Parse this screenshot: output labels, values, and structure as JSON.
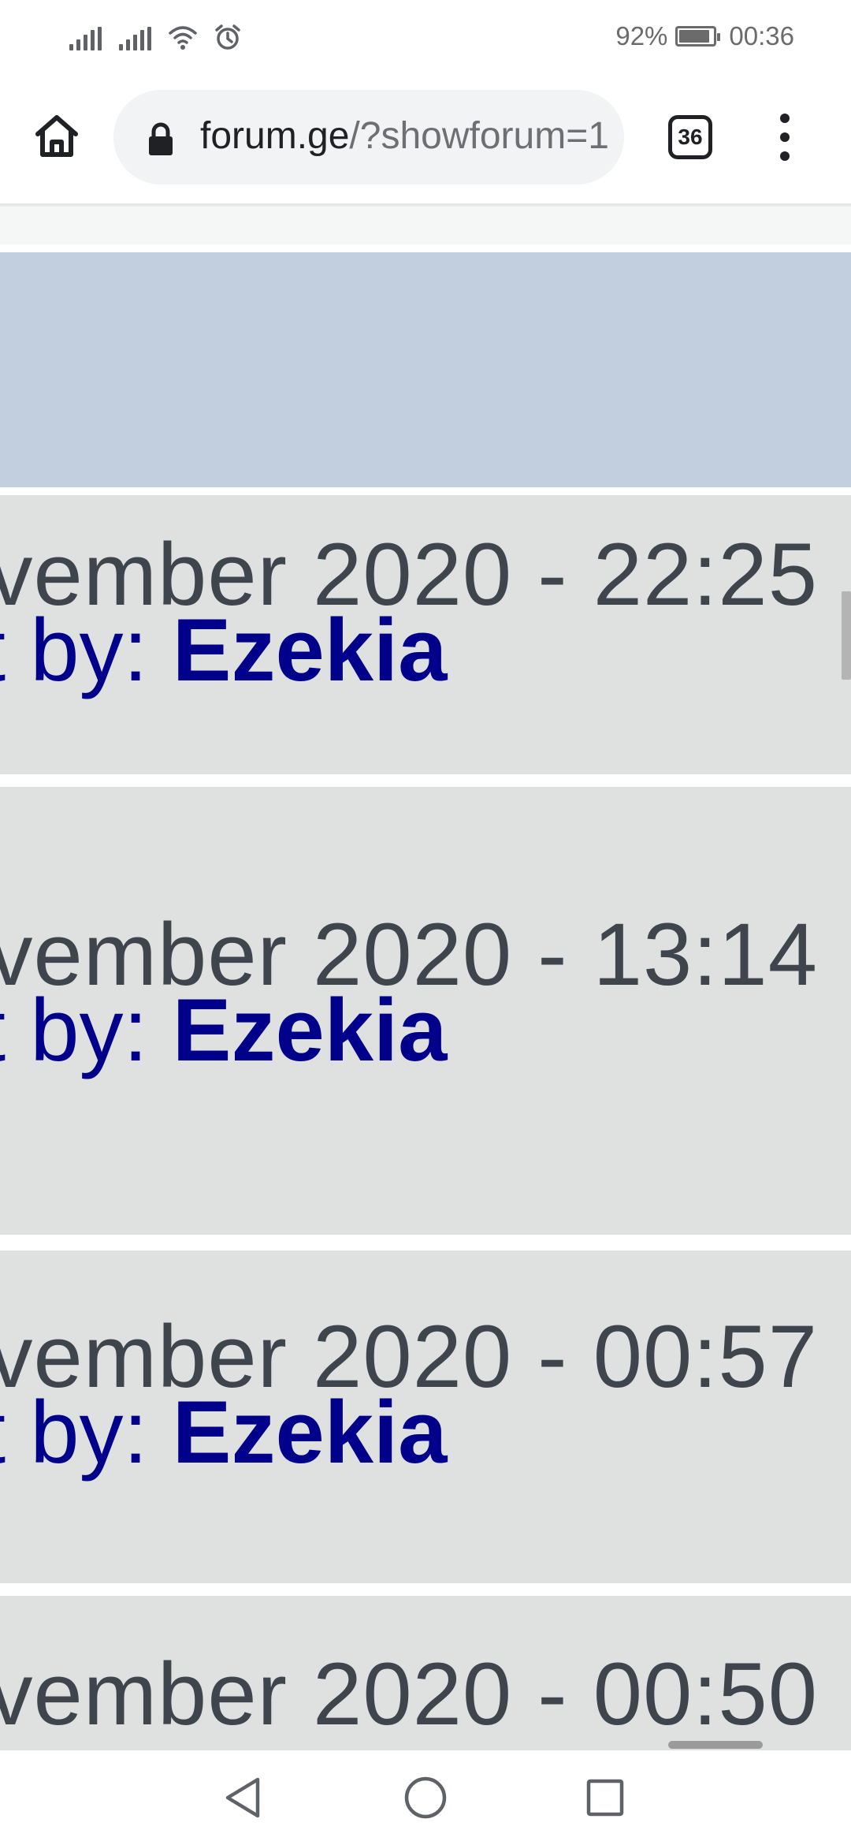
{
  "status_bar": {
    "battery": "92%",
    "time": "00:36",
    "icons": [
      "signal-icon",
      "signal-icon",
      "wifi-icon",
      "alarm-icon",
      "battery-icon"
    ]
  },
  "browser": {
    "url_domain": "forum.ge",
    "url_path": "/?showforum=1",
    "tab_count": "36",
    "icons": [
      "home-icon",
      "lock-icon",
      "tabs-icon",
      "menu-icon"
    ]
  },
  "rows": [
    {
      "date": "vember 2020 - 22:25",
      "by_prefix": "t by: ",
      "author": "Ezekia"
    },
    {
      "date": "vember 2020 - 13:14",
      "by_prefix": "t by: ",
      "author": "Ezekia"
    },
    {
      "date": "vember 2020 - 00:57",
      "by_prefix": "t by: ",
      "author": "Ezekia"
    },
    {
      "date": "vember 2020 - 00:50"
    }
  ],
  "nav_bar": {
    "icons": [
      "back-icon",
      "home-circle-icon",
      "recents-icon"
    ]
  },
  "colors": {
    "header_blue": "#c2cfde",
    "row_grey": "#dfe0e0",
    "date_text": "#3e454d",
    "author_text": "#00008b"
  }
}
